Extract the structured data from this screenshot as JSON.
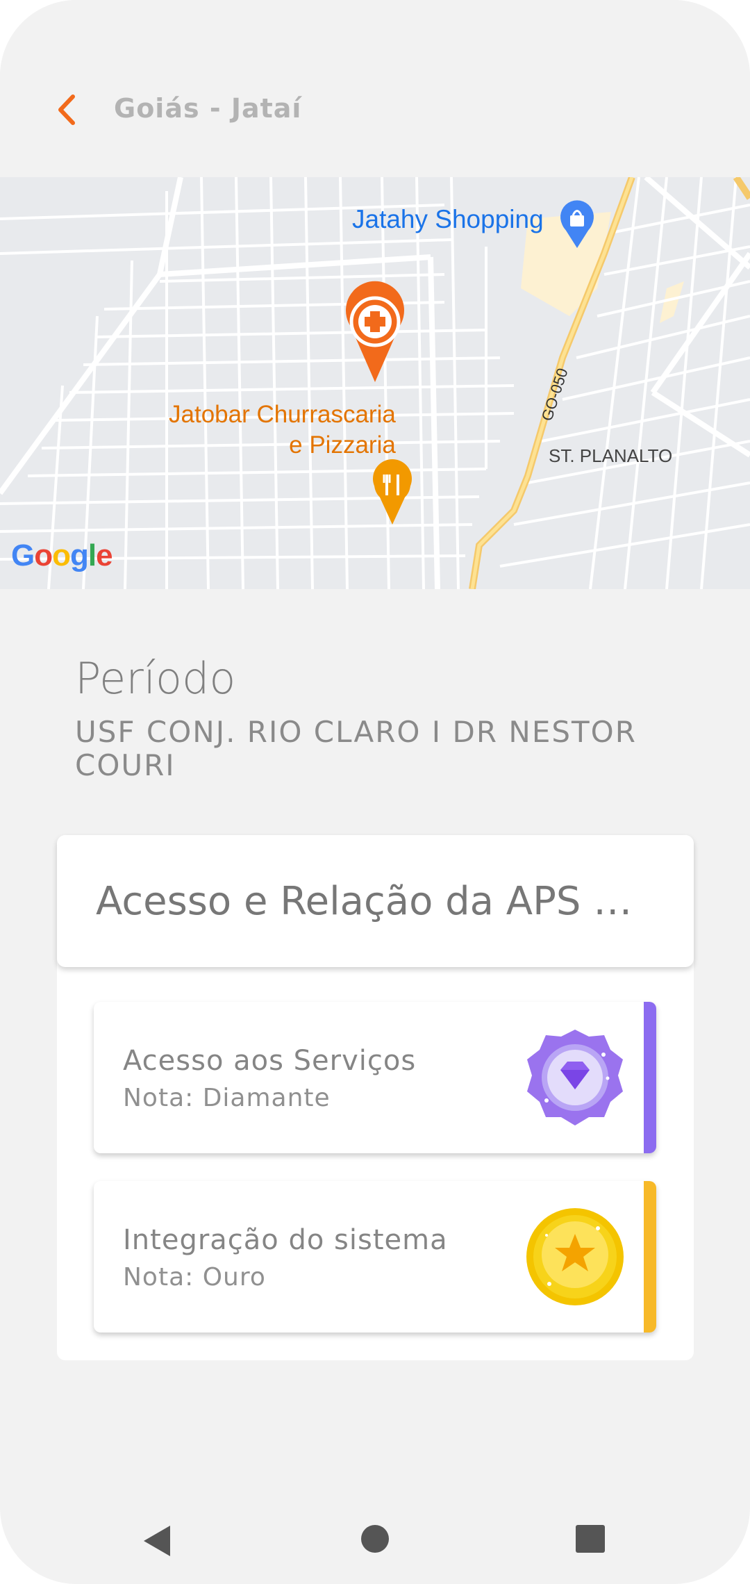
{
  "header": {
    "title": "Goiás - Jataí"
  },
  "map": {
    "labels": {
      "shopping": "Jatahy Shopping",
      "jatobar_line1": "Jatobar Churrascaria",
      "jatobar_line2": "e Pizzaria",
      "planalto": "ST. PLANALTO",
      "road": "GO-050"
    },
    "logo_letters": [
      "G",
      "o",
      "o",
      "g",
      "l",
      "e"
    ],
    "logo_colors": [
      "#4285f4",
      "#ea4335",
      "#fbbc05",
      "#4285f4",
      "#34a853",
      "#ea4335"
    ]
  },
  "periodo": {
    "title": "Período",
    "unit": "USF CONJ. RIO CLARO I DR NESTOR COURI"
  },
  "dimension": {
    "title": "Acesso e Relação da APS c..."
  },
  "items": [
    {
      "name": "Acesso aos Serviços",
      "nota": "Nota: Diamante",
      "medal": "diamond-medal-icon",
      "accent": "#8c6cf0"
    },
    {
      "name": "Integração do sistema",
      "nota": "Nota: Ouro",
      "medal": "gold-medal-icon",
      "accent": "#f7b928"
    }
  ],
  "colors": {
    "accent_orange": "#f26a1b",
    "background": "#f2f2f2"
  }
}
